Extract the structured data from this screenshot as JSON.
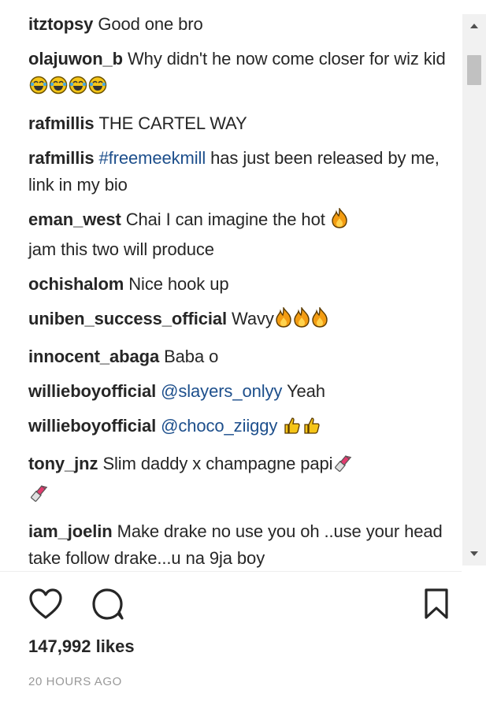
{
  "comments": [
    {
      "user": "itztopsy",
      "text": "Good one bro"
    },
    {
      "user": "olajuwon_b",
      "text": "Why didn't he now come closer for wiz kid",
      "emoji": [
        "laugh-cry-emoji",
        "laugh-cry-emoji",
        "laugh-cry-emoji",
        "laugh-cry-emoji"
      ]
    },
    {
      "user": "rafmillis",
      "text": "THE CARTEL WAY"
    },
    {
      "user": "rafmillis",
      "tag": "#freemeekmill",
      "text": "has just been released by me, link in my bio"
    },
    {
      "user": "eman_west",
      "text": "Chai I can imagine the hot",
      "text2": "jam this two will produce"
    },
    {
      "user": "ochishalom",
      "text": "Nice hook up"
    },
    {
      "user": "uniben_success_official",
      "text": "Wavy",
      "emoji": [
        "fire-emoji",
        "fire-emoji",
        "fire-emoji"
      ]
    },
    {
      "user": "innocent_abaga",
      "text": "Baba o"
    },
    {
      "user": "willieboyofficial",
      "tag": "@slayers_onlyy",
      "text": "Yeah"
    },
    {
      "user": "willieboyofficial",
      "tag": "@choco_ziiggy",
      "emoji": [
        "thumbs-up-emoji",
        "thumbs-up-emoji"
      ]
    },
    {
      "user": "tony_jnz",
      "text": "Slim daddy x champagne papi",
      "emoji": [
        "lipstick-emoji",
        "lipstick-emoji"
      ]
    },
    {
      "user": "iam_joelin",
      "text": "Make drake no use you oh ..use your head take follow drake...u na 9ja boy"
    }
  ],
  "actions": {
    "like_icon": "heart-outline-icon",
    "comment_icon": "comment-bubble-icon",
    "save_icon": "bookmark-icon"
  },
  "likes": "147,992 likes",
  "timestamp": "20 HOURS AGO",
  "colors": {
    "text": "#262626",
    "hashtag": "#1d4f8c",
    "muted": "#999999",
    "fire": "#f39c12",
    "emoji_yellow": "#f5c518"
  }
}
